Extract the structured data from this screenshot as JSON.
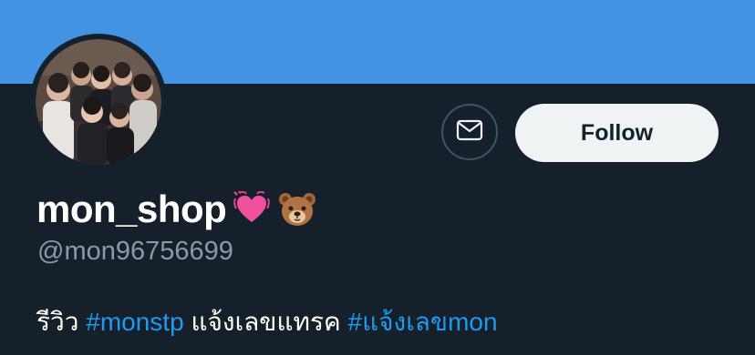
{
  "profile": {
    "display_name": "mon_shop",
    "name_emojis": [
      "beating-heart-emoji",
      "bear-face-emoji"
    ],
    "handle": "@mon96756699",
    "avatar_icon": "group-photo-avatar"
  },
  "actions": {
    "message_icon": "envelope-icon",
    "follow_label": "Follow"
  },
  "bio": {
    "text_1": "รีวิว ",
    "hashtag_1": "#monstp",
    "text_2": " แจ้งเลขแทรค ",
    "hashtag_2": "#แจ้งเลขmon"
  },
  "colors": {
    "banner": "#4294e3",
    "background": "#15202b",
    "hashtag": "#1d9bf0",
    "follow_button_bg": "#eff3f4",
    "handle_text": "#8b98a5"
  }
}
